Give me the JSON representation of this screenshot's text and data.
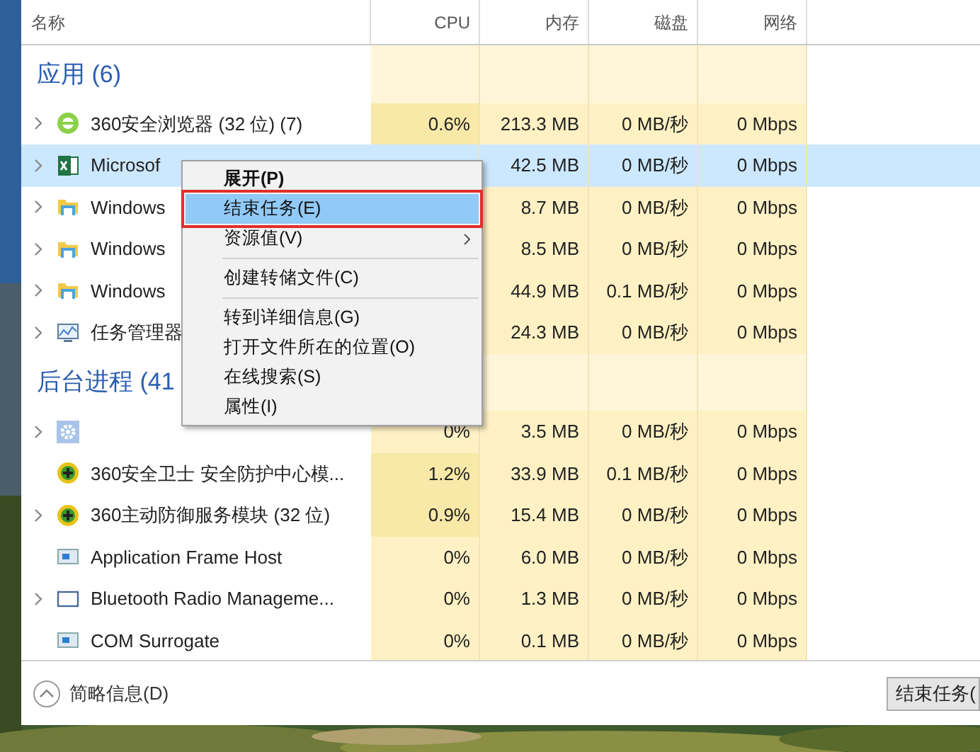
{
  "columns": [
    {
      "label": "名称"
    },
    {
      "label": "CPU"
    },
    {
      "label": "内存"
    },
    {
      "label": "磁盘"
    },
    {
      "label": "网络"
    }
  ],
  "groups": [
    {
      "title": "应用 (6)",
      "rows": [
        {
          "name": "360安全浏览器 (32 位) (7)",
          "kind": "browser",
          "expandable": true,
          "selected": false,
          "cpu": "0.6%",
          "memory": "213.3 MB",
          "disk": "0 MB/秒",
          "network": "0 Mbps"
        },
        {
          "name": "Microsof",
          "kind": "excel",
          "expandable": true,
          "selected": true,
          "memory": "42.5 MB",
          "disk": "0 MB/秒",
          "network": "0 Mbps"
        },
        {
          "name": "Windows",
          "kind": "folder",
          "expandable": true,
          "selected": false,
          "memory": "8.7 MB",
          "disk": "0 MB/秒",
          "network": "0 Mbps"
        },
        {
          "name": "Windows",
          "kind": "folder",
          "expandable": true,
          "selected": false,
          "memory": "8.5 MB",
          "disk": "0 MB/秒",
          "network": "0 Mbps"
        },
        {
          "name": "Windows",
          "kind": "folder",
          "expandable": true,
          "selected": false,
          "memory": "44.9 MB",
          "disk": "0.1 MB/秒",
          "network": "0 Mbps"
        },
        {
          "name": "任务管理器",
          "kind": "monitor",
          "expandable": true,
          "selected": false,
          "memory": "24.3 MB",
          "disk": "0 MB/秒",
          "network": "0 Mbps"
        }
      ]
    },
    {
      "title": "后台进程 (41",
      "rows": [
        {
          "kind": "gear",
          "expandable": true,
          "selected": false,
          "cpu": "0%",
          "memory": "3.5 MB",
          "disk": "0 MB/秒",
          "network": "0 Mbps"
        },
        {
          "name": "360安全卫士 安全防护中心模...",
          "kind": "shield",
          "expandable": false,
          "selected": false,
          "cpu": "1.2%",
          "memory": "33.9 MB",
          "disk": "0.1 MB/秒",
          "network": "0 Mbps"
        },
        {
          "name": "360主动防御服务模块 (32 位)",
          "kind": "shield",
          "expandable": true,
          "selected": false,
          "cpu": "0.9%",
          "memory": "15.4 MB",
          "disk": "0 MB/秒",
          "network": "0 Mbps"
        },
        {
          "name": "Application Frame Host",
          "kind": "app",
          "expandable": false,
          "selected": false,
          "cpu": "0%",
          "memory": "6.0 MB",
          "disk": "0 MB/秒",
          "network": "0 Mbps"
        },
        {
          "name": "Bluetooth Radio Manageme...",
          "kind": "window",
          "expandable": true,
          "selected": false,
          "cpu": "0%",
          "memory": "1.3 MB",
          "disk": "0 MB/秒",
          "network": "0 Mbps"
        },
        {
          "name": "COM Surrogate",
          "kind": "app",
          "expandable": false,
          "selected": false,
          "cpu": "0%",
          "memory": "0.1 MB",
          "disk": "0 MB/秒",
          "network": "0 Mbps"
        }
      ]
    }
  ],
  "context_menu": [
    {
      "kind": "item",
      "label": "展开(P)",
      "bold": true,
      "selected": false,
      "submenu": false
    },
    {
      "kind": "item",
      "label": "结束任务(E)",
      "bold": false,
      "selected": true,
      "submenu": false
    },
    {
      "kind": "item",
      "label": "资源值(V)",
      "bold": false,
      "selected": false,
      "submenu": true
    },
    {
      "kind": "separator"
    },
    {
      "kind": "item",
      "label": "创建转储文件(C)",
      "bold": false,
      "selected": false,
      "submenu": false
    },
    {
      "kind": "separator"
    },
    {
      "kind": "item",
      "label": "转到详细信息(G)",
      "bold": false,
      "selected": false,
      "submenu": false
    },
    {
      "kind": "item",
      "label": "打开文件所在的位置(O)",
      "bold": false,
      "selected": false,
      "submenu": false
    },
    {
      "kind": "item",
      "label": "在线搜索(S)",
      "bold": false,
      "selected": false,
      "submenu": false
    },
    {
      "kind": "item",
      "label": "属性(I)",
      "bold": false,
      "selected": false,
      "submenu": false
    }
  ],
  "footer": {
    "details_toggle": "简略信息(D)",
    "end_task_button": "结束任务("
  }
}
